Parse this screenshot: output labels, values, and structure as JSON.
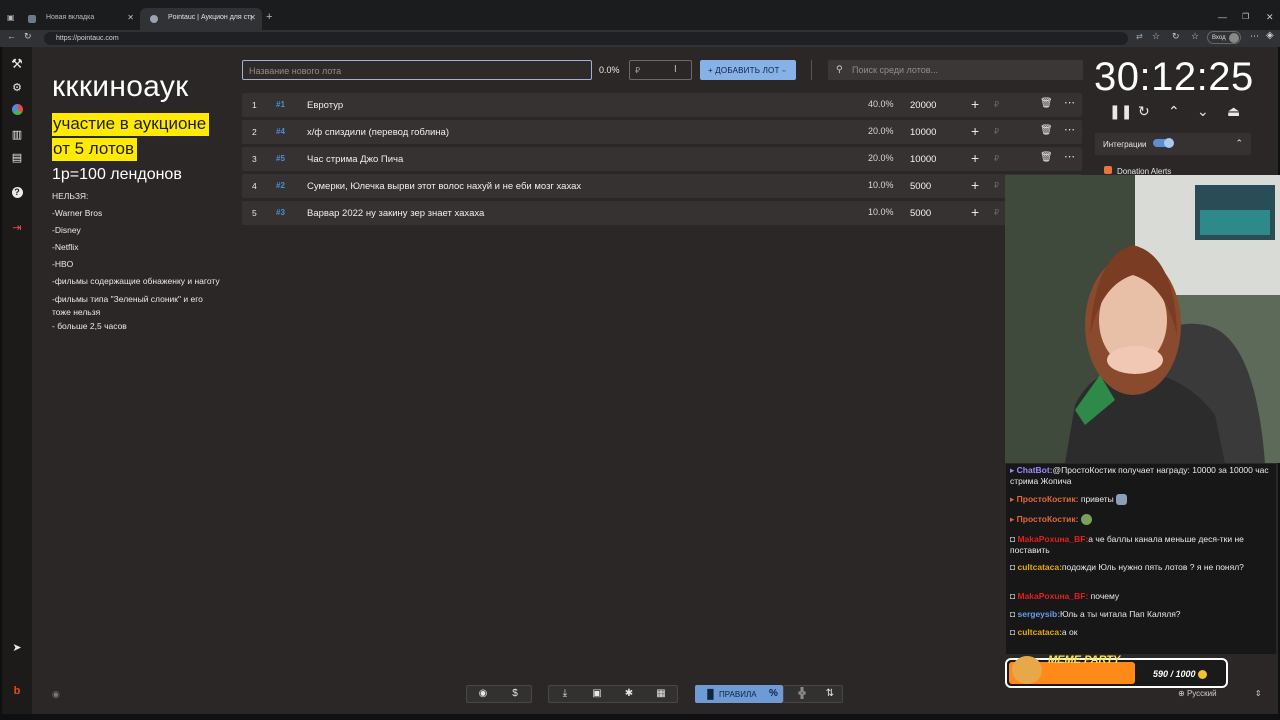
{
  "browser": {
    "tabs": [
      {
        "label": "Новая вкладка"
      },
      {
        "label": "Pointauc | Аукцион для стримеров"
      }
    ],
    "url": "https://pointauc.com",
    "profile_label": "Вход"
  },
  "sidebar": {
    "icons": [
      "gavel-icon",
      "gear-icon",
      "pie-chart-icon",
      "bar-chart-icon",
      "clipboard-icon",
      "help-icon",
      "logout-icon",
      "telegram-icon",
      "brand-icon"
    ]
  },
  "info": {
    "title": "кккиноаук",
    "highlight1": "участие в аукционе",
    "highlight2": "от 5 лотов",
    "rate": "1р=100 лендонов",
    "rules_heading": "НЕЛЬЗЯ:",
    "rules": [
      "-Warner Bros",
      "-Disney",
      "-Netflix",
      "-HBO",
      "-фильмы содержащие обнаженку и наготу",
      "-фильмы типа \"Зеленый слоник\" и его тоже нельзя",
      "- больше 2,5 часов"
    ]
  },
  "controls": {
    "new_lot_placeholder": "Название нового лота",
    "new_lot_percent": "0.0%",
    "amount_placeholder": "₽",
    "add_button": "+ ДОБАВИТЬ ЛОТ",
    "search_placeholder": "Поиск среди лотов..."
  },
  "lots": [
    {
      "num": "1",
      "id": "#1",
      "name": "Евротур",
      "percent": "40.0%",
      "amount": "20000",
      "percent_value": 40
    },
    {
      "num": "2",
      "id": "#4",
      "name": "х/ф спиздили (перевод гоблина)",
      "percent": "20.0%",
      "amount": "10000",
      "percent_value": 20
    },
    {
      "num": "3",
      "id": "#5",
      "name": "Час стрима Джо Пича",
      "percent": "20.0%",
      "amount": "10000",
      "percent_value": 20
    },
    {
      "num": "4",
      "id": "#2",
      "name": "Сумерки, Юлечка вырви этот волос нахуй и не еби мозг хахах",
      "percent": "10.0%",
      "amount": "5000",
      "percent_value": 10
    },
    {
      "num": "5",
      "id": "#3",
      "name": "Варвар 2022 ну закину зер знает хахаха",
      "percent": "10.0%",
      "amount": "5000",
      "percent_value": 10
    }
  ],
  "timer": {
    "value": "30:12:25"
  },
  "integrations": {
    "label": "Интеграции",
    "item": "Donation Alerts"
  },
  "chat": [
    {
      "user": "ChatBot:",
      "user_color": "#9a8cff",
      "text": "@ПростоКостик получает награду: 10000 за 10000 час стрима Жопича"
    },
    {
      "user": "ПростоКостик:",
      "user_color": "#e0683a",
      "text": "приветы"
    },
    {
      "user": "ПростоКостик:",
      "user_color": "#e0683a",
      "text": ""
    },
    {
      "user": "MakaPoxuнa_BF:",
      "user_color": "#e02020",
      "text": "а че баллы канала меньше деся-тки не поставить"
    },
    {
      "user": "cultcataca:",
      "user_color": "#e6a800",
      "text": "подожди Юль нужно пять лотов ? я не понял?"
    },
    {
      "user": "MakaPoxuнa_BF:",
      "user_color": "#e02020",
      "text": "почему"
    },
    {
      "user": "sergeysib:",
      "user_color": "#6a9cf0",
      "text": "Юль а ты читала Пап Каляля?"
    },
    {
      "user": "cultcataca:",
      "user_color": "#e6a800",
      "text": "а ок"
    }
  ],
  "meme_party": {
    "title": "MEME PARTY",
    "count": "590 / 1000",
    "progress": 0.59
  },
  "language": "Русский",
  "bottom_toolbar": {
    "rules_label": "ПРАВИЛА"
  }
}
